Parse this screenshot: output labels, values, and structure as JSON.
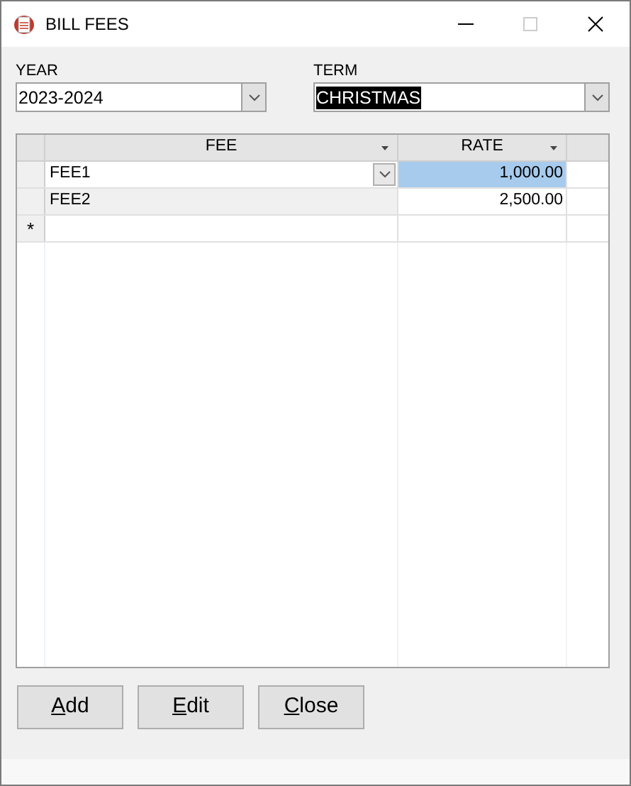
{
  "window": {
    "title": "BILL FEES"
  },
  "year": {
    "label": "YEAR",
    "value": "2023-2024",
    "highlighted": false
  },
  "term": {
    "label": "TERM",
    "value": "CHRISTMAS",
    "highlighted": true
  },
  "grid": {
    "columns": [
      "FEE",
      "RATE"
    ],
    "rows": [
      {
        "fee": "FEE1",
        "rate": "1,000.00",
        "current": true,
        "rate_selected": true
      },
      {
        "fee": "FEE2",
        "rate": "2,500.00",
        "current": false,
        "rate_selected": false
      }
    ],
    "new_row_marker": "*"
  },
  "buttons": [
    {
      "label": "Add"
    },
    {
      "label": "Edit"
    },
    {
      "label": "Close"
    }
  ]
}
